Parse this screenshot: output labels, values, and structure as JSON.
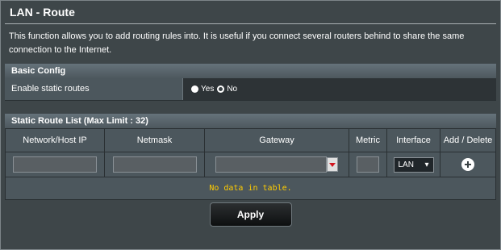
{
  "page": {
    "title": "LAN - Route",
    "description": "This function allows you to add routing rules into. It is useful if you connect several routers behind to share the same connection to the Internet."
  },
  "basic_config": {
    "section_title": "Basic Config",
    "enable_static_routes": {
      "label": "Enable static routes",
      "options": [
        "Yes",
        "No"
      ],
      "selected": "No"
    }
  },
  "static_route_list": {
    "section_title": "Static Route List (Max Limit : 32)",
    "columns": [
      "Network/Host IP",
      "Netmask",
      "Gateway",
      "Metric",
      "Interface",
      "Add / Delete"
    ],
    "input_row": {
      "network_host_ip": "",
      "netmask": "",
      "gateway": "",
      "metric": "",
      "interface": "LAN"
    },
    "empty_message": "No data in table."
  },
  "actions": {
    "apply_label": "Apply"
  }
}
